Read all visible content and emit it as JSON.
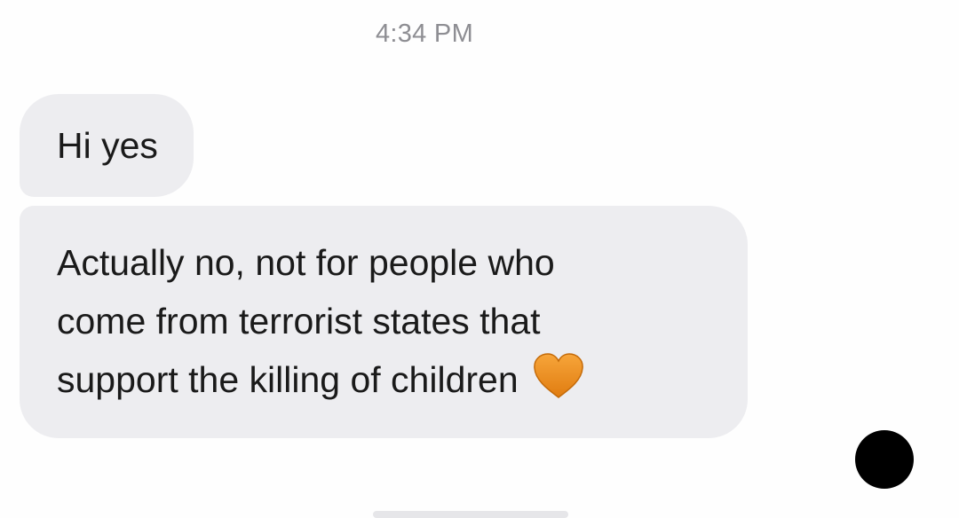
{
  "conversation": {
    "timestamp": "4:34 PM",
    "messages": [
      {
        "text": "Hi yes"
      },
      {
        "lines": [
          "Actually no, not for people who",
          "come from terrorist states that",
          "support the killing of children"
        ],
        "emoji": "orange-heart"
      }
    ]
  },
  "colors": {
    "bubble_incoming": "#ededf0",
    "timestamp": "#8e8e93",
    "heart": "#f0901e",
    "dot": "#000000"
  }
}
